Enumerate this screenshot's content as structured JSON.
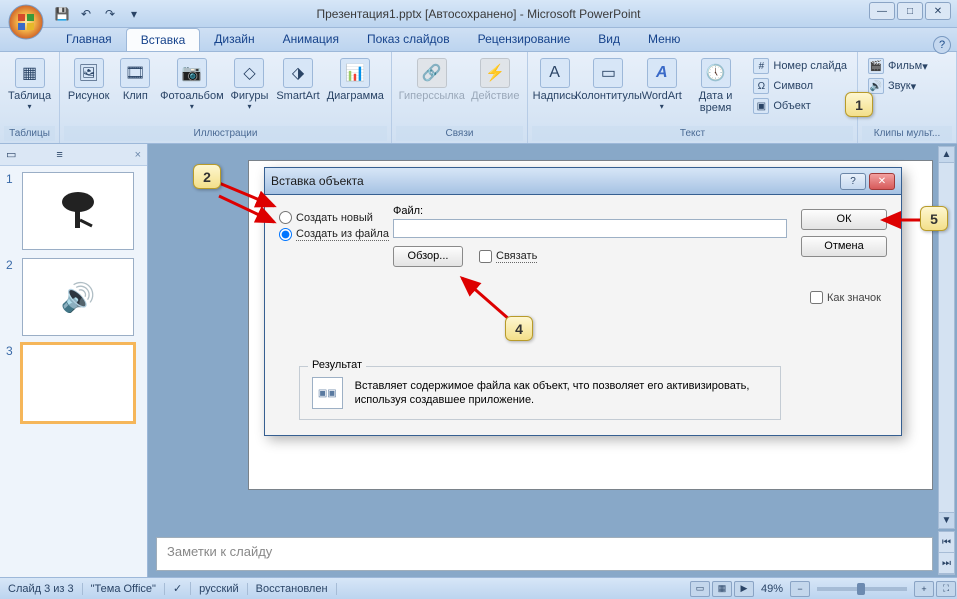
{
  "app_title": "Презентация1.pptx [Автосохранено] - Microsoft PowerPoint",
  "tabs": {
    "home": "Главная",
    "insert": "Вставка",
    "design": "Дизайн",
    "anim": "Анимация",
    "slideshow": "Показ слайдов",
    "review": "Рецензирование",
    "view": "Вид",
    "menu": "Меню"
  },
  "ribbon": {
    "tables": {
      "table": "Таблица",
      "group": "Таблицы"
    },
    "illus": {
      "picture": "Рисунок",
      "clip": "Клип",
      "photoalbum": "Фотоальбом",
      "shapes": "Фигуры",
      "smartart": "SmartArt",
      "chart": "Диаграмма",
      "group": "Иллюстрации"
    },
    "links": {
      "hyperlink": "Гиперссылка",
      "action": "Действие",
      "group": "Связи"
    },
    "text": {
      "textbox": "Надпись",
      "headerfooter": "Колонтитулы",
      "wordart": "WordArt",
      "datetime": "Дата и время",
      "slide_num": "Номер слайда",
      "symbol": "Символ",
      "object": "Объект",
      "group": "Текст"
    },
    "media": {
      "movie": "Фильм",
      "sound": "Звук",
      "group": "Клипы мульт..."
    }
  },
  "slides": {
    "n1": "1",
    "n2": "2",
    "n3": "3"
  },
  "notes_placeholder": "Заметки к слайду",
  "statusbar": {
    "slide": "Слайд 3 из 3",
    "theme": "\"Тема Office\"",
    "lang": "русский",
    "saved": "Восстановлен",
    "zoom": "49%"
  },
  "dialog": {
    "title": "Вставка объекта",
    "radio_new": "Создать новый",
    "radio_file": "Создать из файла",
    "file_label": "Файл:",
    "browse": "Обзор...",
    "link": "Связать",
    "ok": "ОК",
    "cancel": "Отмена",
    "as_icon": "Как значок",
    "result_label": "Результат",
    "result_text": "Вставляет содержимое файла как объект, что позволяет его активизировать, используя создавшее приложение."
  },
  "markers": {
    "m1": "1",
    "m2": "2",
    "m4": "4",
    "m5": "5"
  }
}
